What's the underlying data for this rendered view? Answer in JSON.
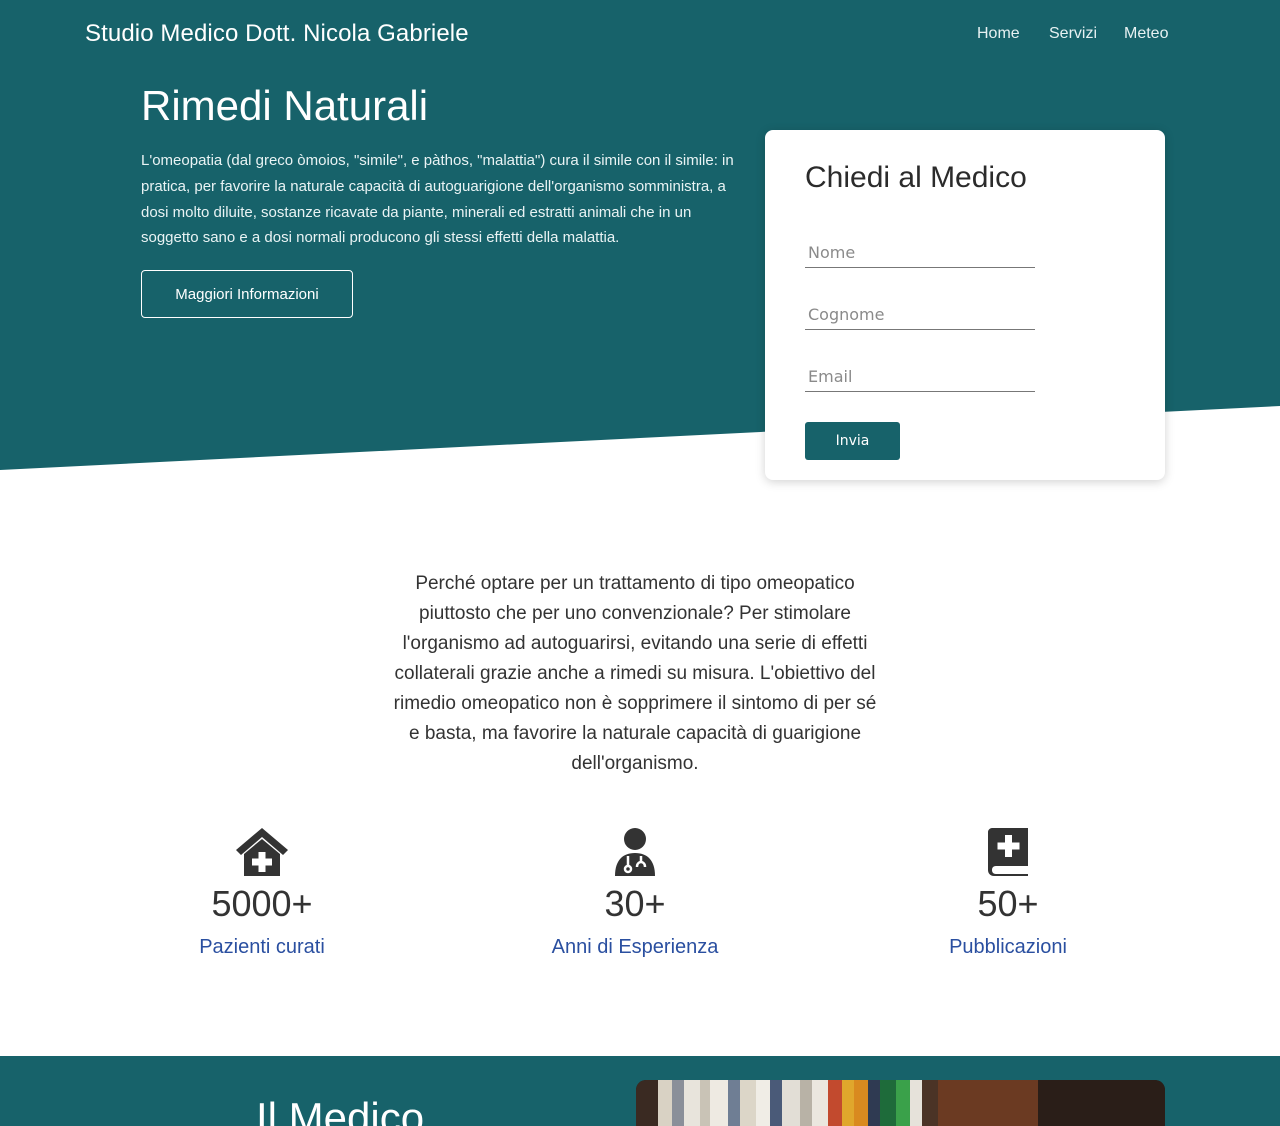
{
  "header": {
    "brand": "Studio Medico Dott. Nicola Gabriele",
    "nav": [
      "Home",
      "Servizi",
      "Meteo"
    ]
  },
  "hero": {
    "title": "Rimedi Naturali",
    "text": "L'omeopatia (dal greco òmoios, \"simile\", e pàthos, \"malattia\") cura il simile con il simile: in pratica, per favorire la naturale capacità di autoguarigione dell'organismo somministra, a dosi molto diluite, sostanze ricavate da piante, minerali ed estratti animali che in un soggetto sano e a dosi normali producono gli stessi effetti della malattia.",
    "button_label": "Maggiori Informazioni"
  },
  "form": {
    "title": "Chiedi al Medico",
    "nome_placeholder": "Nome",
    "cognome_placeholder": "Cognome",
    "email_placeholder": "Email",
    "submit_label": "Invia"
  },
  "intro": {
    "text": "Perché optare per un trattamento di tipo omeopatico piuttosto che per uno convenzionale? Per stimolare l'organismo ad autoguarirsi, evitando una serie di effetti collaterali grazie anche a rimedi su misura. L'obiettivo del rimedio omeopatico non è sopprimere il sintomo di per sé e basta, ma favorire la naturale capacità di guarigione dell'organismo."
  },
  "stats": [
    {
      "icon": "house-medical-icon",
      "value": "5000+",
      "label": "Pazienti curati"
    },
    {
      "icon": "user-doctor-icon",
      "value": "30+",
      "label": "Anni di Esperienza"
    },
    {
      "icon": "book-medical-icon",
      "value": "50+",
      "label": "Pubblicazioni"
    }
  ],
  "about": {
    "title": "Il Medico"
  },
  "colors": {
    "brand_teal": "#17626a",
    "link_blue": "#2a4fa0",
    "text_dark": "#333333"
  }
}
